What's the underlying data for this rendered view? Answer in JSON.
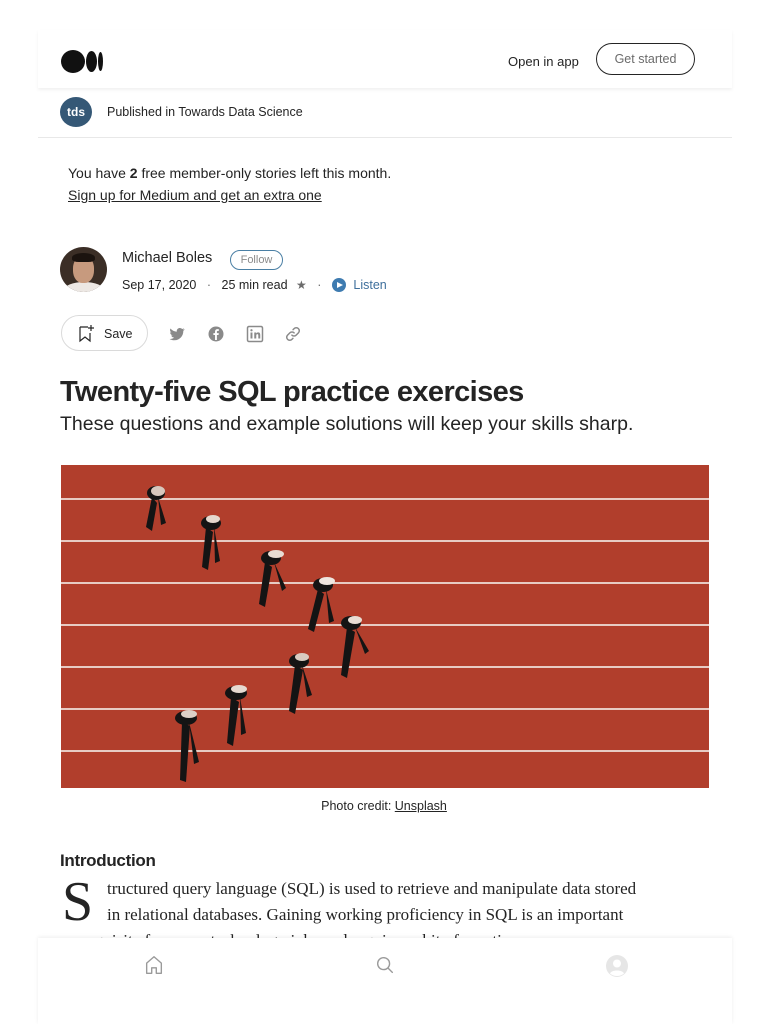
{
  "header": {
    "logo": "medium-logo",
    "open_in_app": "Open in app",
    "get_started": "Get started"
  },
  "publication": {
    "logo_text": "tds",
    "label": "Published in Towards Data Science"
  },
  "member_notice": {
    "prefix": "You have ",
    "count": "2",
    "suffix": " free member-only stories left this month.",
    "signup_link": "Sign up for Medium and get an extra one"
  },
  "author": {
    "name": "Michael Boles",
    "follow": "Follow",
    "date": "Sep 17, 2020",
    "read_time": "25 min read",
    "separator": "·",
    "star": "★",
    "listen": "Listen"
  },
  "actions": {
    "save": "Save",
    "share_icons": [
      "twitter-icon",
      "facebook-icon",
      "linkedin-icon",
      "link-icon"
    ]
  },
  "article": {
    "title": "Twenty-five SQL practice exercises",
    "subtitle": "These questions and example solutions will keep your skills sharp.",
    "caption_prefix": "Photo credit: ",
    "caption_link": "Unsplash",
    "section_heading": "Introduction",
    "dropcap": "S",
    "para_line1": "tructured query language (SQL) is used to retrieve and manipulate data stored",
    "para_line2": "in relational databases. Gaining working proficiency in SQL is an important",
    "para_line3": "prerequisite for many technology jobs and requires a bit of practice."
  },
  "bottom_nav": {
    "items": [
      "home-icon",
      "search-icon",
      "profile-icon"
    ]
  },
  "colors": {
    "track": "#b8412e",
    "accent_blue": "#3e7bb0",
    "text": "#242424"
  }
}
